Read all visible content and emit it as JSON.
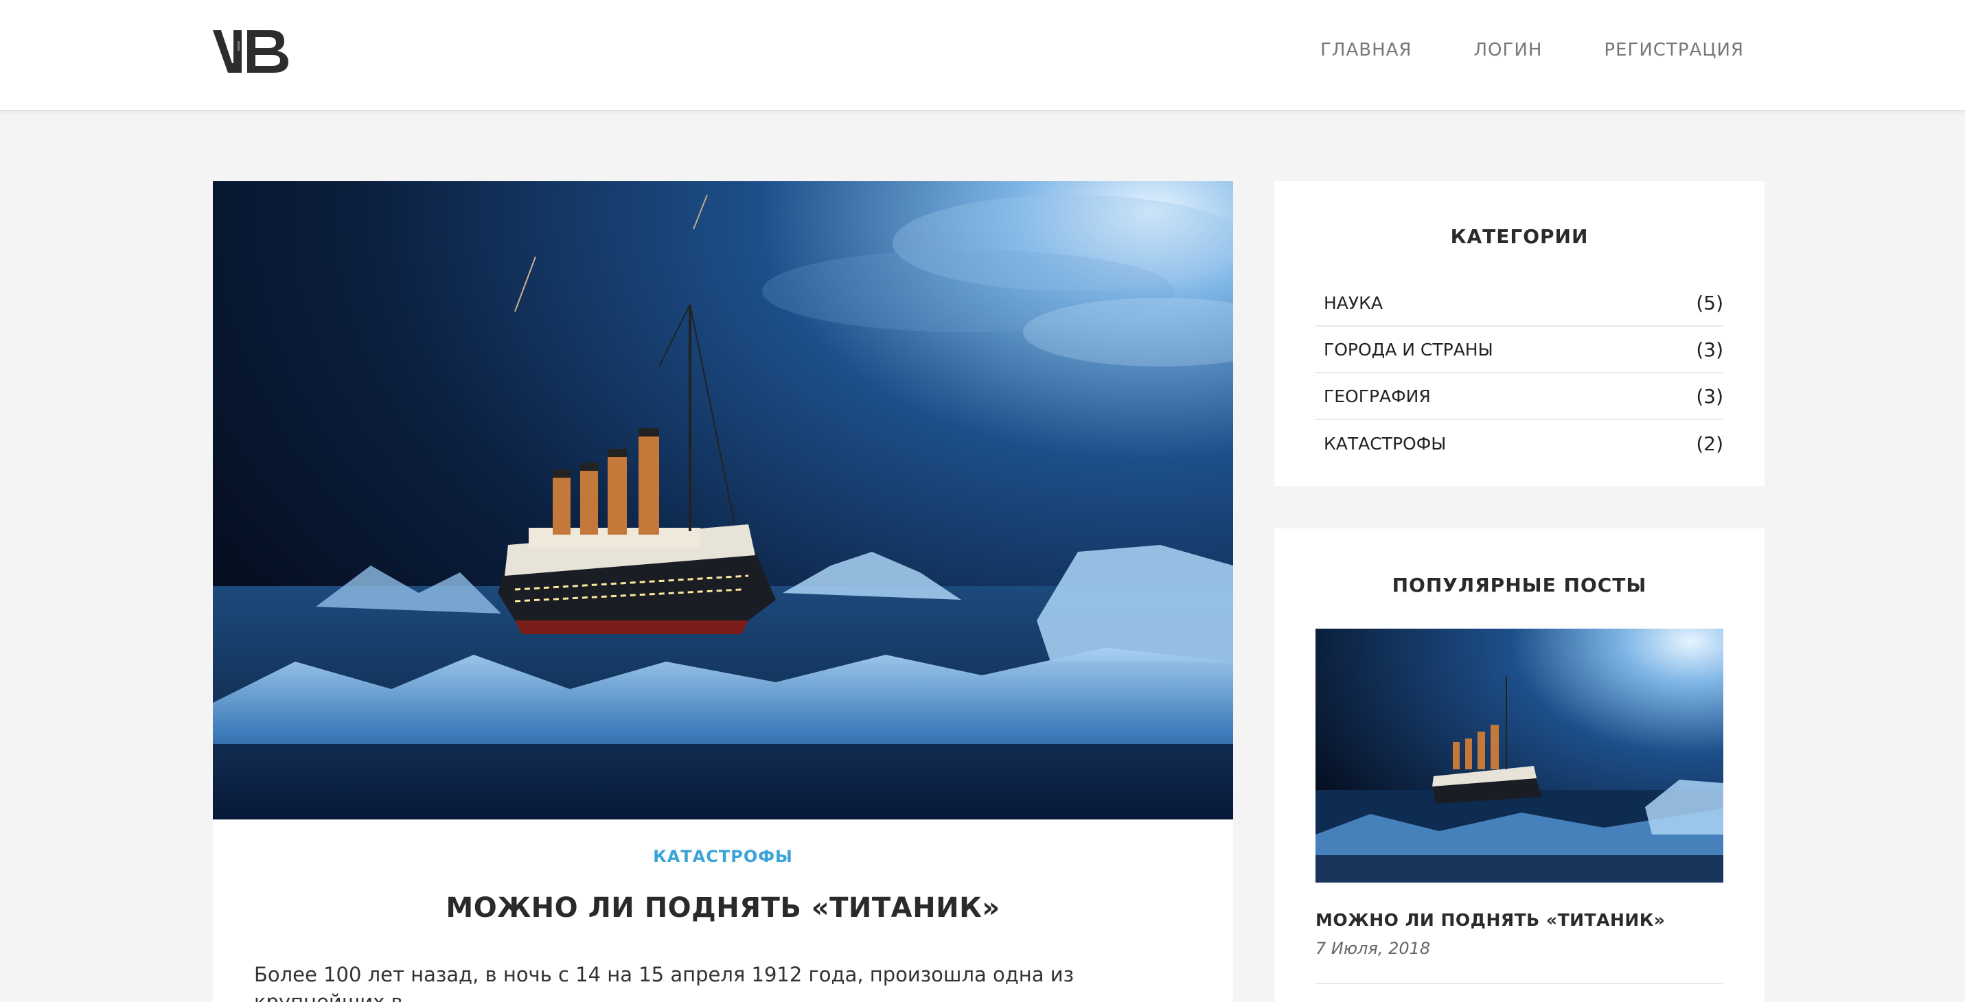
{
  "header": {
    "logo_text": "VB",
    "nav": [
      "ГЛАВНАЯ",
      "ЛОГИН",
      "РЕГИСТРАЦИЯ"
    ]
  },
  "article": {
    "category": "КАТАСТРОФЫ",
    "title": "МОЖНО ЛИ ПОДНЯТЬ «ТИТАНИК»",
    "excerpt": "Более 100 лет назад, в ночь с 14 на 15 апреля 1912 года, произошла одна из крупнейших в"
  },
  "sidebar": {
    "categories": {
      "title": "КАТЕГОРИИ",
      "items": [
        {
          "label": "НАУКА",
          "count": "(5)"
        },
        {
          "label": "ГОРОДА И СТРАНЫ",
          "count": "(3)"
        },
        {
          "label": "ГЕОГРАФИЯ",
          "count": "(3)"
        },
        {
          "label": "КАТАСТРОФЫ",
          "count": "(2)"
        }
      ]
    },
    "popular": {
      "title": "ПОПУЛЯРНЫЕ ПОСТЫ",
      "post_title": "МОЖНО ЛИ ПОДНЯТЬ «ТИТАНИК»",
      "post_date": "7 Июля, 2018"
    }
  },
  "colors": {
    "accent": "#3aa3d8",
    "background": "#f4f4f4",
    "card": "#ffffff"
  }
}
